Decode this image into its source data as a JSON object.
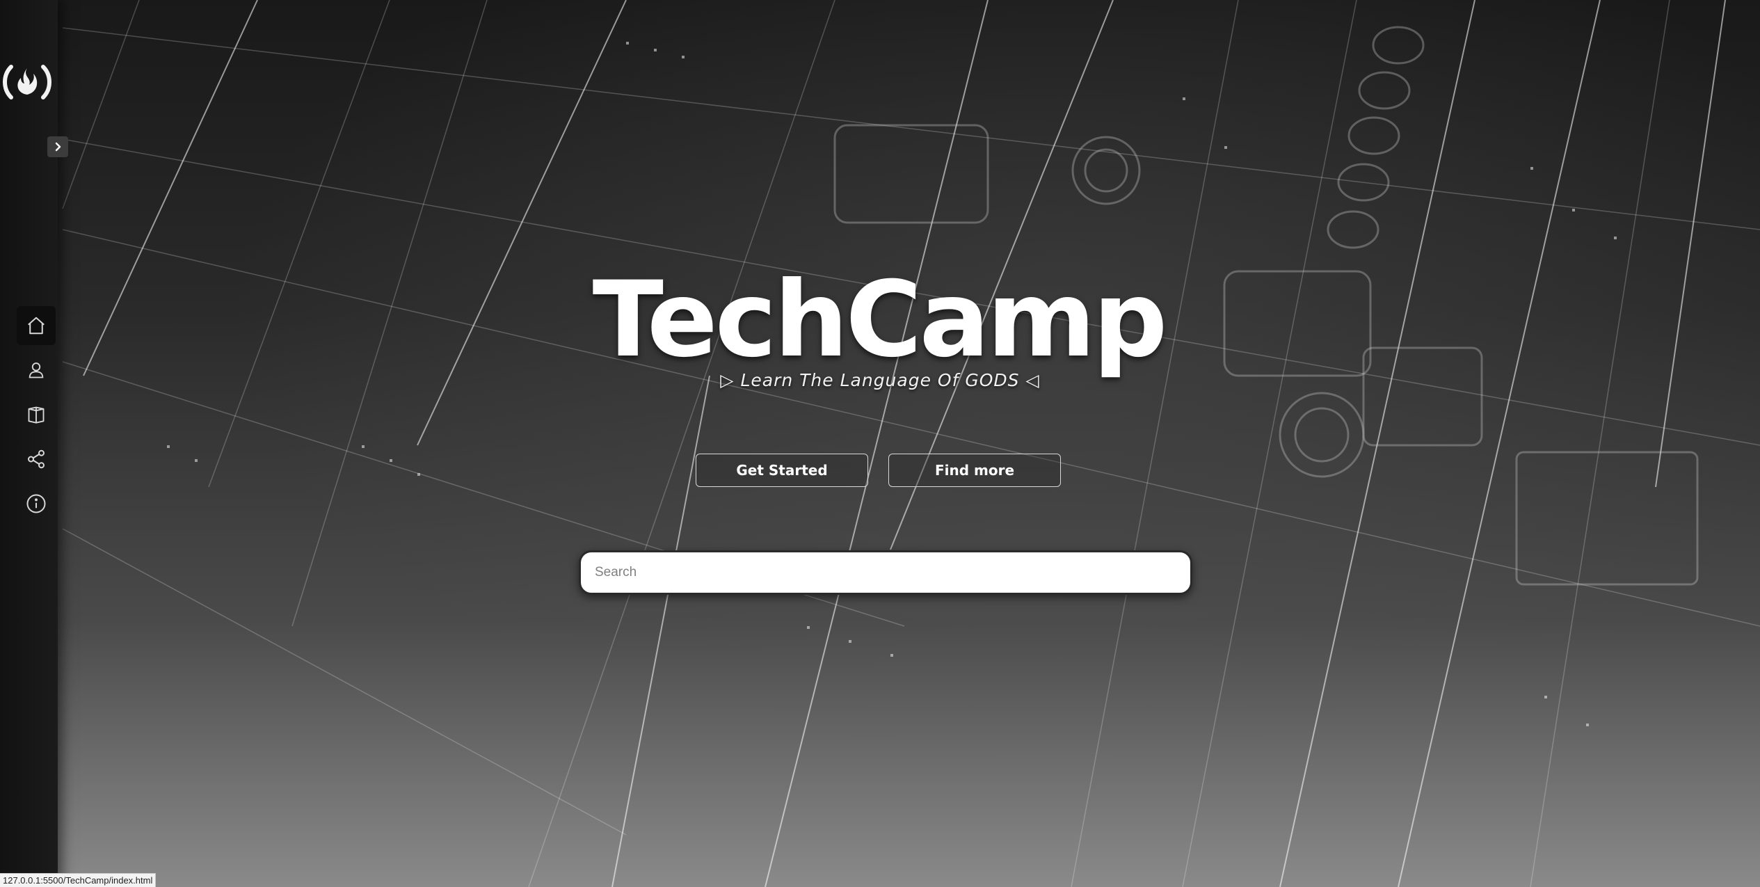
{
  "app": {
    "title": "TechCamp",
    "subtitle": "▷ Learn The Language Of GODS ◁"
  },
  "sidebar": {
    "logo": {
      "icon": "freecodecamp-flame-icon"
    },
    "expand_icon": "chevron-right-icon",
    "items": [
      {
        "icon": "home-icon",
        "active": true
      },
      {
        "icon": "user-icon",
        "active": false
      },
      {
        "icon": "book-icon",
        "active": false
      },
      {
        "icon": "share-icon",
        "active": false
      },
      {
        "icon": "info-icon",
        "active": false
      }
    ]
  },
  "hero": {
    "primary_button": "Get Started",
    "secondary_button": "Find more"
  },
  "search": {
    "placeholder": "Search",
    "value": ""
  },
  "status_bar": {
    "url": "127.0.0.1:5500/TechCamp/index.html"
  },
  "colors": {
    "sidebar_bg": "#161616",
    "accent_text": "#ffffff",
    "button_border": "#d8d8d8",
    "search_bg": "#ffffff"
  }
}
